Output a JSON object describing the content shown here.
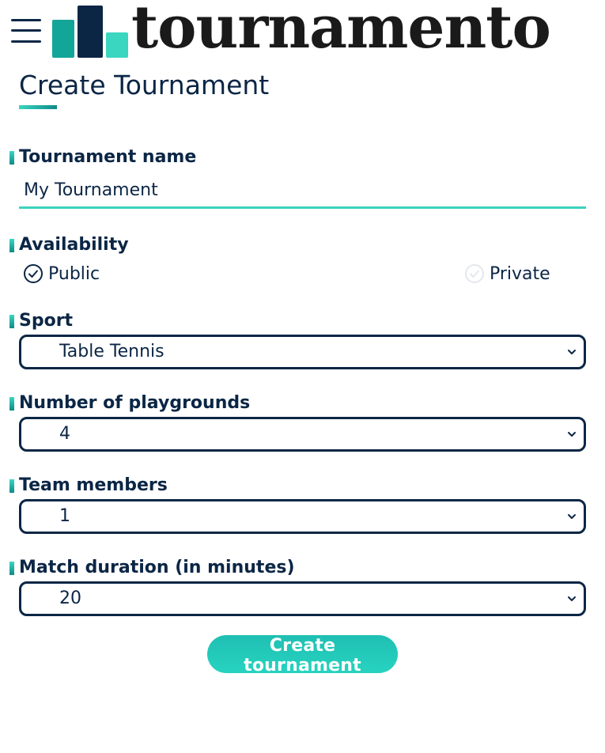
{
  "header": {
    "menu_icon": "hamburger-menu-icon",
    "logo_text": "tournamento",
    "logo_colors": [
      "#13a597",
      "#0b2645",
      "#3ad6c0"
    ]
  },
  "page": {
    "title": "Create Tournament"
  },
  "form": {
    "tournament_name": {
      "label": "Tournament name",
      "value": "My Tournament"
    },
    "availability": {
      "label": "Availability",
      "options": [
        {
          "label": "Public",
          "selected": true
        },
        {
          "label": "Private",
          "selected": false
        }
      ]
    },
    "sport": {
      "label": "Sport",
      "selected": "Table Tennis"
    },
    "playgrounds": {
      "label": "Number of playgrounds",
      "selected": "4"
    },
    "team_members": {
      "label": "Team members",
      "selected": "1"
    },
    "match_duration": {
      "label": "Match duration (in minutes)",
      "selected": "20"
    },
    "submit_label": "Create tournament"
  },
  "colors": {
    "primary": "#0b2645",
    "accent": "#27d3c0",
    "accent_dark": "#0f8a87"
  }
}
